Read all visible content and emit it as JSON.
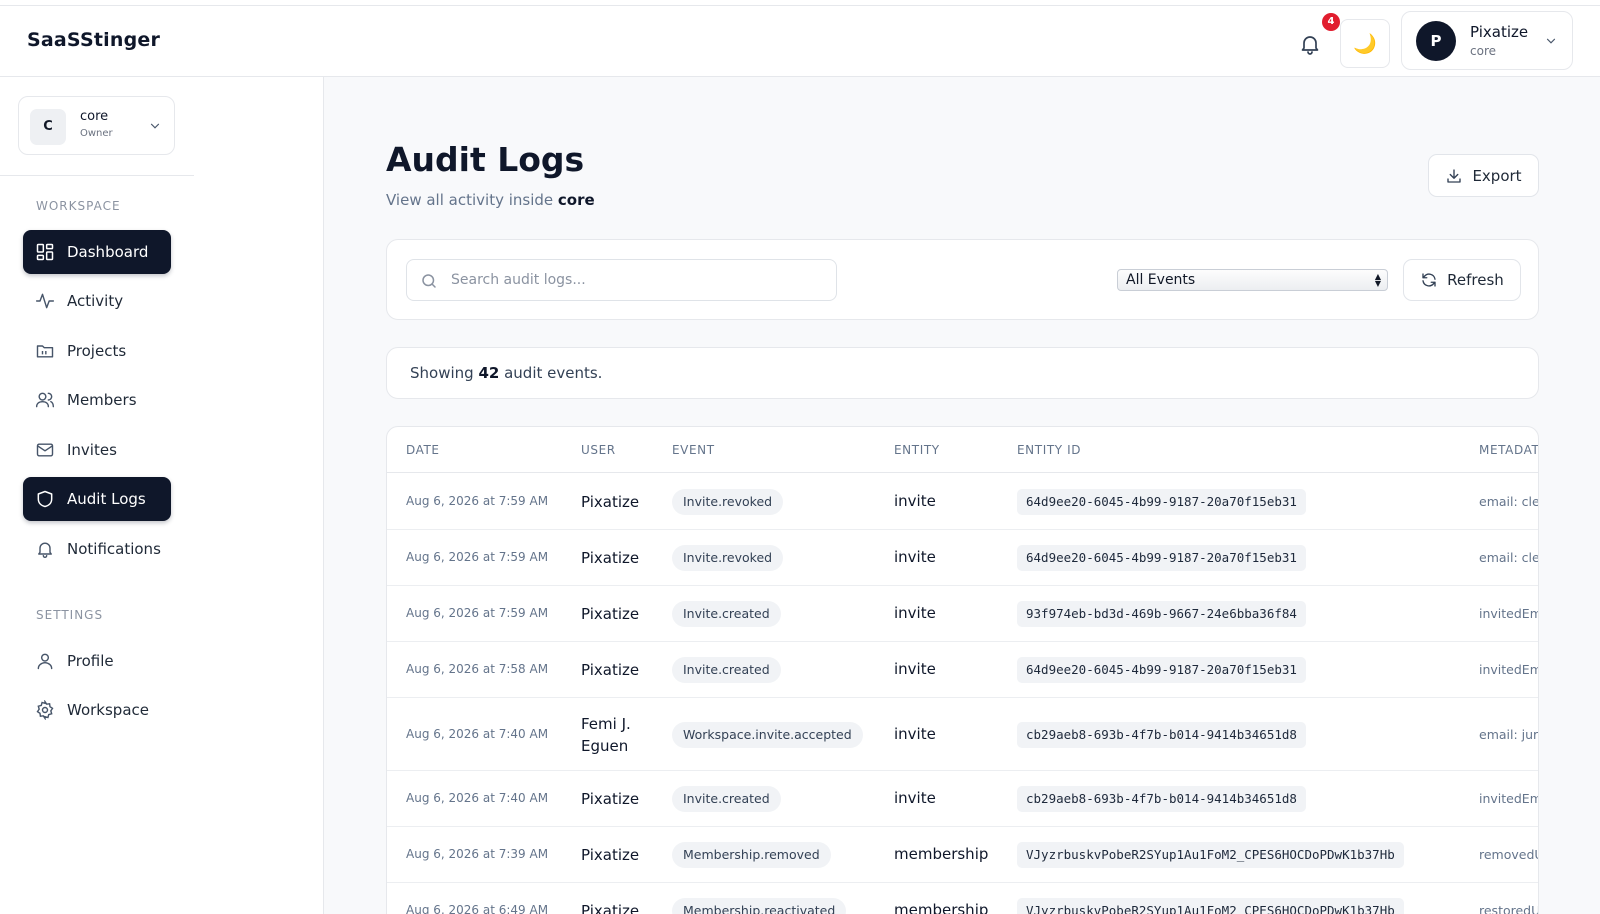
{
  "app": {
    "brand": "SaaSStinger"
  },
  "header": {
    "notification_count": "4",
    "theme_icon": "🌙",
    "user": {
      "initial": "P",
      "name": "Pixatize",
      "workspace": "core"
    }
  },
  "sidebar": {
    "workspace": {
      "initial": "C",
      "name": "core",
      "role": "Owner"
    },
    "sections": [
      {
        "label": "WORKSPACE"
      },
      {
        "label": "SETTINGS"
      }
    ],
    "items": [
      {
        "label": "Dashboard",
        "icon": "dashboard-icon",
        "active": true
      },
      {
        "label": "Activity",
        "icon": "activity-icon"
      },
      {
        "label": "Projects",
        "icon": "folder-icon"
      },
      {
        "label": "Members",
        "icon": "users-icon"
      },
      {
        "label": "Invites",
        "icon": "mail-icon"
      },
      {
        "label": "Audit Logs",
        "icon": "shield-icon",
        "active": true
      },
      {
        "label": "Notifications",
        "icon": "bell-icon"
      },
      {
        "label": "Profile",
        "icon": "user-icon"
      },
      {
        "label": "Workspace",
        "icon": "gear-icon"
      }
    ]
  },
  "main": {
    "title": "Audit Logs",
    "subtitle_prefix": "View all activity inside",
    "subtitle_workspace": "core",
    "export_label": "Export",
    "search_placeholder": "Search audit logs...",
    "filter_selected": "All Events",
    "refresh_label": "Refresh",
    "count_prefix": "Showing",
    "count_value": "42",
    "count_suffix": "audit events.",
    "table": {
      "columns": [
        "DATE",
        "USER",
        "EVENT",
        "ENTITY",
        "ENTITY ID",
        "METADAT"
      ],
      "rows": [
        {
          "date": "Aug 6, 2026 at 7:59 AM",
          "user": "Pixatize",
          "user2": "",
          "event": "Invite.revoked",
          "entity": "invite",
          "entity_id": "64d9ee20-6045-4b99-9187-20a70f15eb31",
          "metadata": "email: cle"
        },
        {
          "date": "Aug 6, 2026 at 7:59 AM",
          "user": "Pixatize",
          "user2": "",
          "event": "Invite.revoked",
          "entity": "invite",
          "entity_id": "64d9ee20-6045-4b99-9187-20a70f15eb31",
          "metadata": "email: cle"
        },
        {
          "date": "Aug 6, 2026 at 7:59 AM",
          "user": "Pixatize",
          "user2": "",
          "event": "Invite.created",
          "entity": "invite",
          "entity_id": "93f974eb-bd3d-469b-9667-24e6bba36f84",
          "metadata": "invitedEm"
        },
        {
          "date": "Aug 6, 2026 at 7:58 AM",
          "user": "Pixatize",
          "user2": "",
          "event": "Invite.created",
          "entity": "invite",
          "entity_id": "64d9ee20-6045-4b99-9187-20a70f15eb31",
          "metadata": "invitedEm"
        },
        {
          "date": "Aug 6, 2026 at 7:40 AM",
          "user": "Femi J.",
          "user2": "Eguen",
          "event": "Workspace.invite.accepted",
          "entity": "invite",
          "entity_id": "cb29aeb8-693b-4f7b-b014-9414b34651d8",
          "metadata": "email: jur"
        },
        {
          "date": "Aug 6, 2026 at 7:40 AM",
          "user": "Pixatize",
          "user2": "",
          "event": "Invite.created",
          "entity": "invite",
          "entity_id": "cb29aeb8-693b-4f7b-b014-9414b34651d8",
          "metadata": "invitedEm"
        },
        {
          "date": "Aug 6, 2026 at 7:39 AM",
          "user": "Pixatize",
          "user2": "",
          "event": "Membership.removed",
          "entity": "membership",
          "entity_id": "VJyzrbuskvPobeR2SYup1Au1FoM2_CPES6HOCDoPDwK1b37Hb",
          "metadata": "removedU"
        },
        {
          "date": "Aug 6, 2026 at 6:49 AM",
          "user": "Pixatize",
          "user2": "",
          "event": "Membership.reactivated",
          "entity": "membership",
          "entity_id": "VJyzrbuskvPobeR2SYup1Au1FoM2_CPES6HOCDoPDwK1b37Hb",
          "metadata": "restoredU"
        }
      ]
    }
  }
}
